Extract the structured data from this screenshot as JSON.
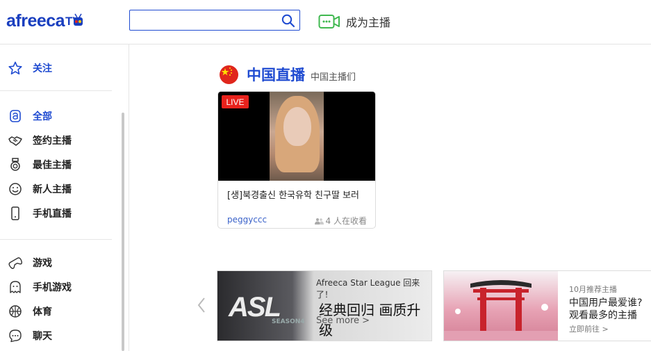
{
  "header": {
    "logo_text": "afreeca",
    "search": {
      "value": "",
      "placeholder": ""
    },
    "broadcast_label": "成为主播"
  },
  "sidebar": {
    "items": [
      {
        "label": "关注",
        "icon": "star-icon"
      },
      {
        "label": "全部",
        "icon": "all-icon",
        "active": true
      },
      {
        "label": "签约主播",
        "icon": "handshake-icon"
      },
      {
        "label": "最佳主播",
        "icon": "medal-icon"
      },
      {
        "label": "新人主播",
        "icon": "smile-icon"
      },
      {
        "label": "手机直播",
        "icon": "mobile-icon"
      },
      {
        "label": "游戏",
        "icon": "gamepad-icon"
      },
      {
        "label": "手机游戏",
        "icon": "ghost-icon"
      },
      {
        "label": "体育",
        "icon": "ball-icon"
      },
      {
        "label": "聊天",
        "icon": "chat-icon"
      }
    ]
  },
  "section": {
    "title": "中国直播",
    "subtitle": "中国主播们"
  },
  "stream_card": {
    "badge": "LIVE",
    "title": "[생]북경출신 한국유학 친구딸 보러",
    "user": "peggyccc",
    "viewers": "4 人在收看"
  },
  "banners": [
    {
      "logo": "ASL",
      "season": "SEASON4",
      "top": "Afreeca Star League 回来了！",
      "main": "经典回归 画质升级",
      "more": "See more >"
    },
    {
      "top": "10月推荐主播",
      "line1": "中国用户最爱谁?",
      "line2": "观看最多的主播",
      "link": "立即前往 >"
    }
  ],
  "colors": {
    "brand_blue": "#1f4bd1",
    "live_red": "#e8221c",
    "broadcast_green": "#3fb84f"
  }
}
